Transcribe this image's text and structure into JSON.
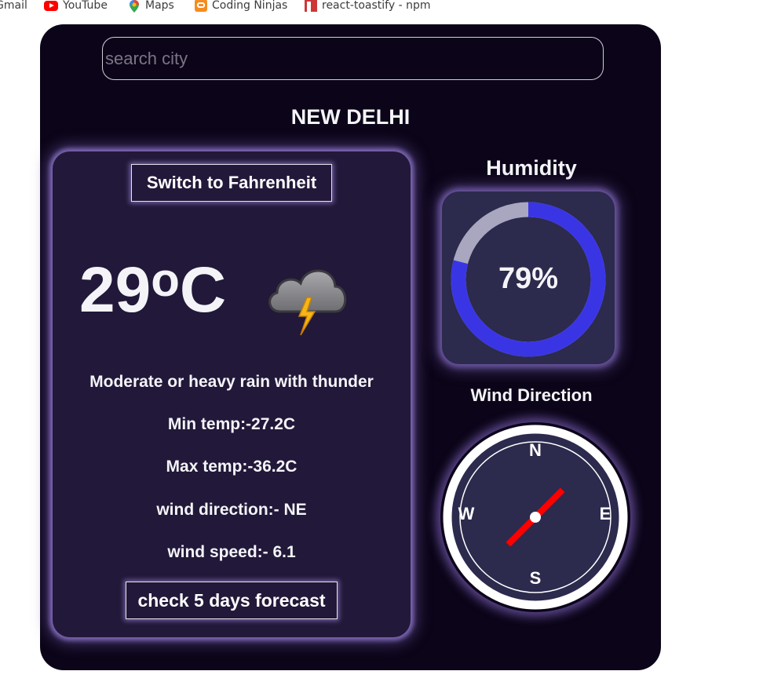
{
  "bookmarks": [
    {
      "label": "Gmail",
      "icon": "gmail-icon"
    },
    {
      "label": "YouTube",
      "icon": "youtube-icon"
    },
    {
      "label": "Maps",
      "icon": "maps-icon"
    },
    {
      "label": "Coding Ninjas",
      "icon": "coding-ninjas-icon"
    },
    {
      "label": "react-toastify - npm",
      "icon": "npm-icon"
    }
  ],
  "search": {
    "placeholder": "search city",
    "value": ""
  },
  "city": "NEW DELHI",
  "weather": {
    "switch_label": "Switch to Fahrenheit",
    "temp_value": "29",
    "temp_degree": "o",
    "temp_unit": "C",
    "condition_icon": "thunder-cloud-icon",
    "condition": "Moderate or heavy rain with thunder",
    "min_temp": "Min temp:-27.2C",
    "max_temp": "Max temp:-36.2C",
    "wind_direction": "wind direction:- NE",
    "wind_speed": "wind speed:- 6.1",
    "forecast_label": "check 5 days forecast"
  },
  "humidity": {
    "title": "Humidity",
    "label": "79%",
    "percent": 79,
    "fill_color": "#3a35e4",
    "track_color": "#a9a7bf"
  },
  "wind": {
    "title": "Wind Direction",
    "north": "N",
    "east": "E",
    "south": "S",
    "west": "W",
    "needle_color": "#ff0000",
    "needle_heading": "NE"
  }
}
